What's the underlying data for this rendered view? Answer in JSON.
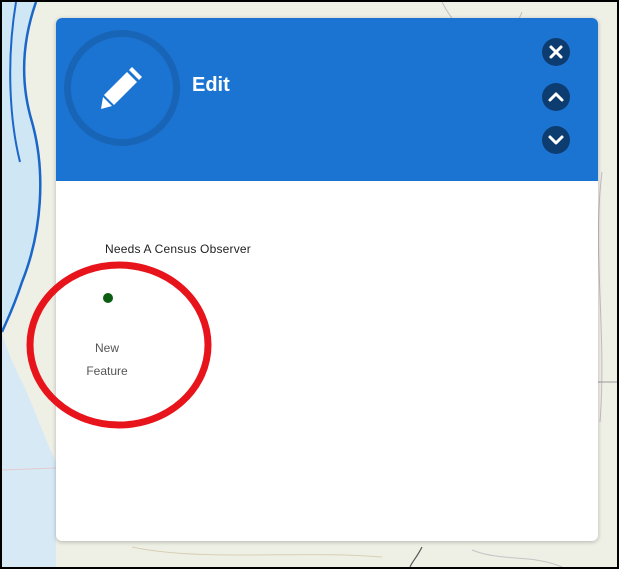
{
  "panel": {
    "title": "Edit",
    "header_color": "#1c74d2",
    "header_button_color": "#0d3d70",
    "icon": "pencil-icon",
    "buttons": [
      {
        "name": "close-button",
        "icon": "close-icon"
      },
      {
        "name": "previous-button",
        "icon": "chevron-up-icon"
      },
      {
        "name": "next-button",
        "icon": "chevron-down-icon"
      }
    ]
  },
  "template_picker": {
    "layer_name": "Needs A Census Observer",
    "templates": [
      {
        "label_line1": "New",
        "label_line2": "Feature",
        "symbol_color": "#0b5d12"
      }
    ]
  },
  "annotation": {
    "type": "highlight-circle",
    "color": "#e8141c"
  }
}
